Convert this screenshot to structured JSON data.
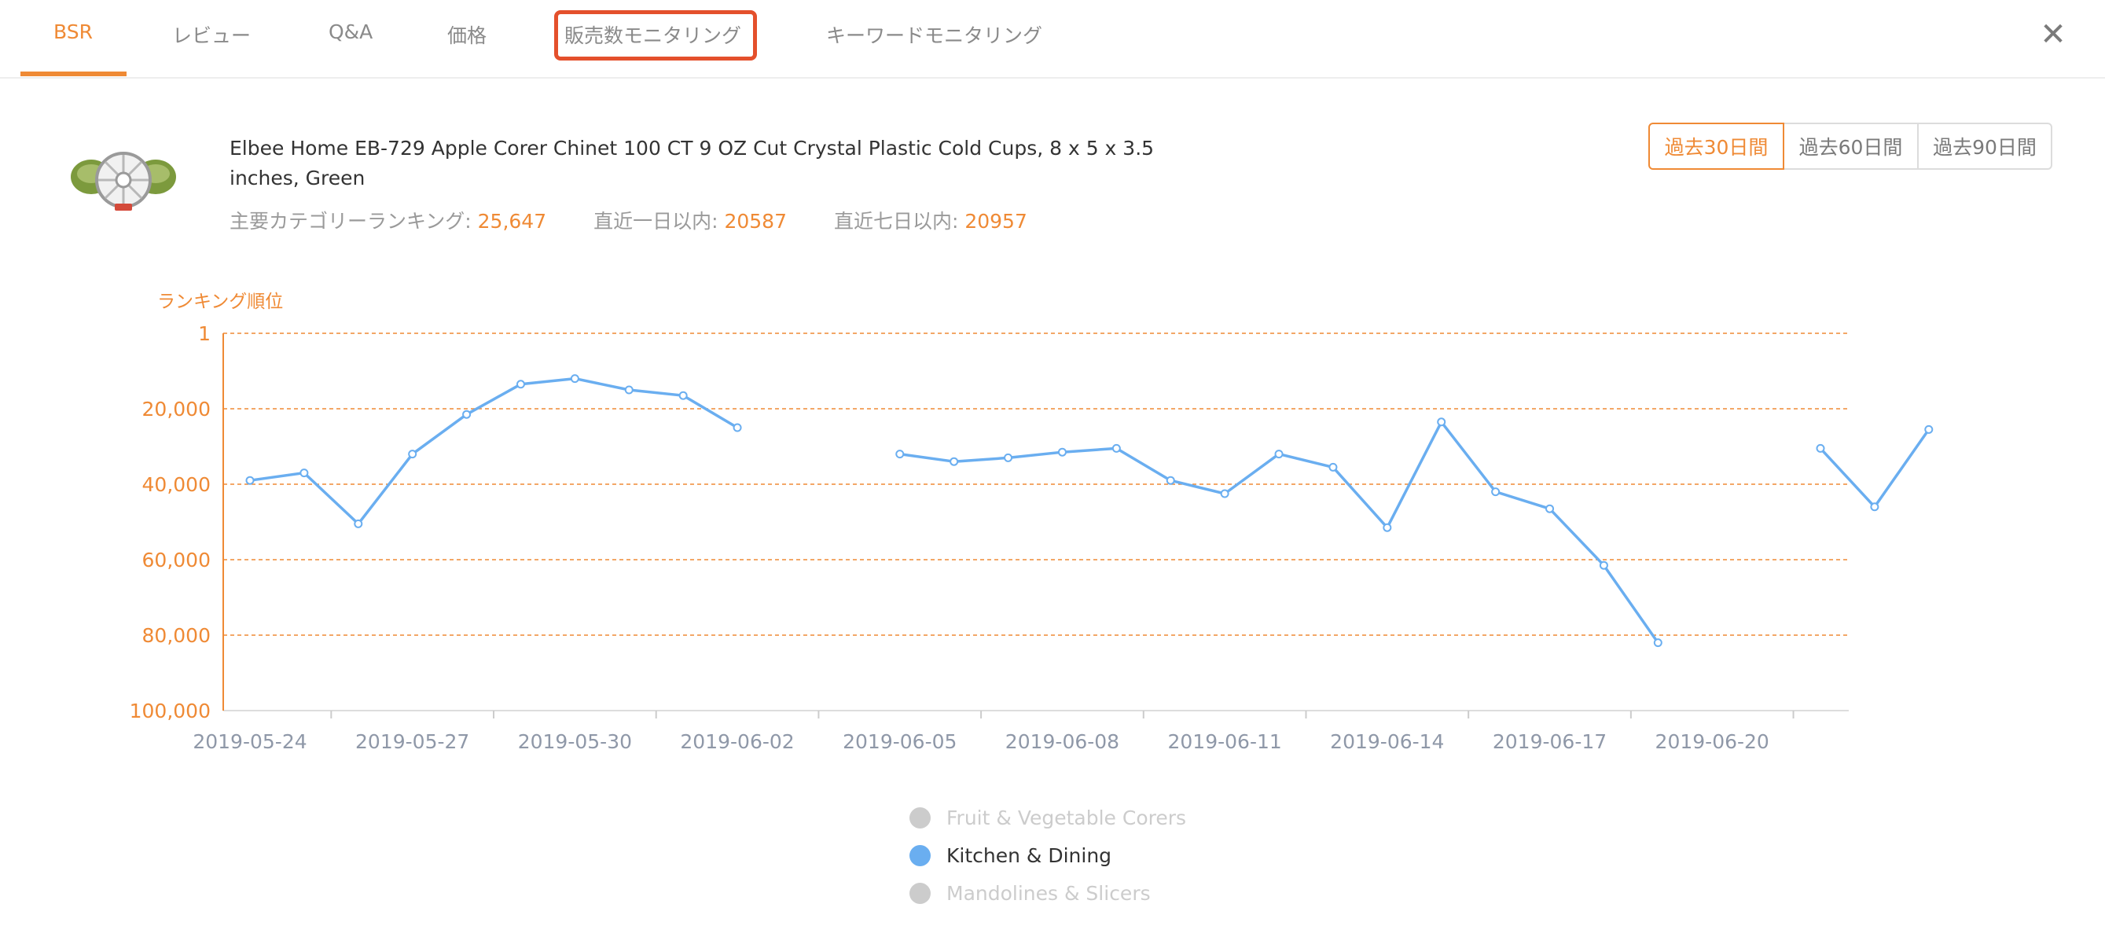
{
  "tabs": [
    {
      "label": "BSR",
      "active": true
    },
    {
      "label": "レビュー",
      "active": false
    },
    {
      "label": "Q&A",
      "active": false
    },
    {
      "label": "価格",
      "active": false
    },
    {
      "label": "販売数モニタリング",
      "active": false
    },
    {
      "label": "キーワードモニタリング",
      "active": false
    }
  ],
  "close_icon": "close-icon",
  "product": {
    "title": "Elbee Home EB-729 Apple Corer Chinet 100 CT 9 OZ Cut Crystal Plastic Cold Cups, 8 x 5 x 3.5 inches, Green",
    "image_icon": "apple-corer-product-image",
    "main_rank_label": "主要カテゴリーランキング:",
    "main_rank_value": "25,647",
    "last_day_label": "直近一日以内:",
    "last_day_value": "20587",
    "last_week_label": "直近七日以内:",
    "last_week_value": "20957"
  },
  "range_buttons": [
    {
      "label": "過去30日間",
      "selected": true
    },
    {
      "label": "過去60日間",
      "selected": false
    },
    {
      "label": "過去90日間",
      "selected": false
    }
  ],
  "colors": {
    "accent": "#ef8a35",
    "series": "#6aaef0",
    "legend_inactive": "#cccccc",
    "highlight_box": "#e4502c"
  },
  "chart_data": {
    "type": "line",
    "ylabel": "ランキング順位",
    "y_inverted": true,
    "ylim": [
      1,
      100000
    ],
    "y_ticks": [
      "1",
      "20,000",
      "40,000",
      "60,000",
      "80,000",
      "100,000"
    ],
    "y_tick_values": [
      1,
      20000,
      40000,
      60000,
      80000,
      100000
    ],
    "x_tick_labels": [
      "2019-05-24",
      "2019-05-27",
      "2019-05-30",
      "2019-06-02",
      "2019-06-05",
      "2019-06-08",
      "2019-06-11",
      "2019-06-14",
      "2019-06-17",
      "2019-06-20"
    ],
    "x": [
      "2019-05-24",
      "2019-05-25",
      "2019-05-26",
      "2019-05-27",
      "2019-05-28",
      "2019-05-29",
      "2019-05-30",
      "2019-05-31",
      "2019-06-01",
      "2019-06-02",
      "2019-06-03",
      "2019-06-04",
      "2019-06-05",
      "2019-06-06",
      "2019-06-07",
      "2019-06-08",
      "2019-06-09",
      "2019-06-10",
      "2019-06-11",
      "2019-06-12",
      "2019-06-13",
      "2019-06-14",
      "2019-06-15",
      "2019-06-16",
      "2019-06-17",
      "2019-06-18",
      "2019-06-19",
      "2019-06-20",
      "2019-06-21",
      "2019-06-22"
    ],
    "grid": true,
    "legend_position": "bottom",
    "series": [
      {
        "name": "Fruit & Vegetable Corers",
        "active": false,
        "values": []
      },
      {
        "name": "Kitchen & Dining",
        "active": true,
        "values": [
          39000,
          37000,
          50500,
          32000,
          21500,
          13500,
          12000,
          15000,
          16500,
          25000,
          null,
          null,
          32000,
          34000,
          33000,
          31500,
          30500,
          39000,
          42500,
          32000,
          35500,
          51500,
          23500,
          42000,
          46500,
          61500,
          82000,
          null,
          null,
          30500,
          46000,
          25500
        ]
      },
      {
        "name": "Mandolines & Slicers",
        "active": false,
        "values": []
      }
    ]
  }
}
